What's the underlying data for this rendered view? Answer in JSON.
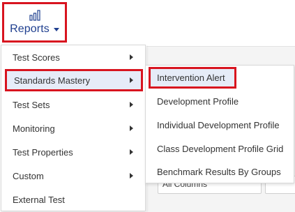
{
  "nav": {
    "reports_label": "Reports",
    "reports_icon": "bar-chart-icon"
  },
  "background": {
    "field_left": "All Columns",
    "field_right": ""
  },
  "menu": {
    "items": [
      {
        "label": "Test Scores",
        "has_submenu": true
      },
      {
        "label": "Standards Mastery",
        "has_submenu": true
      },
      {
        "label": "Test Sets",
        "has_submenu": true
      },
      {
        "label": "Monitoring",
        "has_submenu": true
      },
      {
        "label": "Test Properties",
        "has_submenu": true
      },
      {
        "label": "Custom",
        "has_submenu": true
      },
      {
        "label": "External Test",
        "has_submenu": false
      }
    ]
  },
  "submenu": {
    "items": [
      {
        "label": "Intervention Alert"
      },
      {
        "label": "Development Profile"
      },
      {
        "label": "Individual Development Profile"
      },
      {
        "label": "Class Development Profile Grid"
      },
      {
        "label": "Benchmark Results By Groups"
      }
    ]
  },
  "colors": {
    "highlight_border": "#d8141f",
    "nav_text": "#1f3f8f",
    "active_bg": "#e6ecf8"
  }
}
